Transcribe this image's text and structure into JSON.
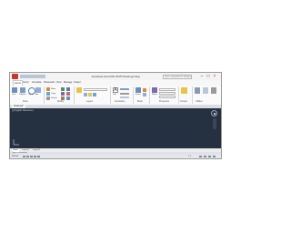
{
  "app": {
    "title": "Autodesk AutoCAD 2015   Drawing1.dwg",
    "search_placeholder": "Type a keyword or phrase",
    "window_controls": [
      "–",
      "□",
      "×"
    ]
  },
  "ribbon": {
    "tabs": [
      {
        "label": "Home",
        "active": true
      },
      {
        "label": "Insert",
        "active": false
      },
      {
        "label": "Annotate",
        "active": false
      },
      {
        "label": "Parametric",
        "active": false
      },
      {
        "label": "View",
        "active": false
      },
      {
        "label": "Manage",
        "active": false
      },
      {
        "label": "Output",
        "active": false
      }
    ],
    "panels": [
      {
        "title": "Draw"
      },
      {
        "title": "Modify"
      },
      {
        "title": "Layers"
      },
      {
        "title": "Annotation"
      },
      {
        "title": "Block"
      },
      {
        "title": "Properties"
      },
      {
        "title": "Groups"
      },
      {
        "title": "Utilities"
      }
    ],
    "tools": [
      "Line",
      "Polyline",
      "Circle",
      "Arc",
      "Move",
      "Copy",
      "Stretch",
      "Text",
      "Insert",
      "Match"
    ]
  },
  "document": {
    "tab_label": "Drawing1*",
    "viewport_label": "[-][Top][2D Wireframe]"
  },
  "layout_tabs": [
    {
      "label": "Model",
      "active": true
    },
    {
      "label": "Layout1",
      "active": false
    },
    {
      "label": "Layout2",
      "active": false
    }
  ],
  "command": {
    "placeholder": "Type a command"
  },
  "status": {
    "mode": "MODEL",
    "scale": "1:1"
  },
  "colors": {
    "canvas": "#253041",
    "accent": "#c0392b"
  }
}
